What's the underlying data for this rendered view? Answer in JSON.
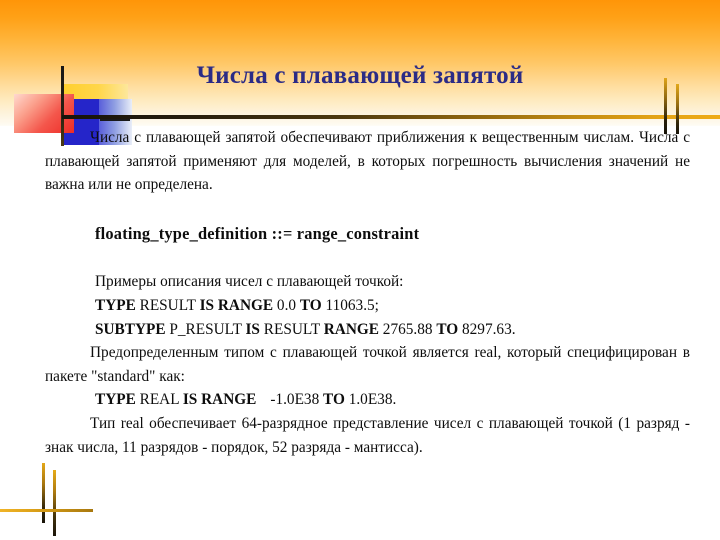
{
  "slide": {
    "title": "Числа с плавающей запятой",
    "title_color": "#2b2b86",
    "background_top_color": "#ff9508",
    "background_bottom_color": "#ffffff",
    "accent_gold": "#e0a419",
    "accent_dark": "#161208"
  },
  "body": {
    "paragraph1_line1": "Числа с плавающей запятой обеспечивают приближения к",
    "paragraph1_line2": "вещественным числам. Числа с плавающей запятой применяют для",
    "paragraph1_line3": "моделей, в которых погрешность вычисления значений не важна или не",
    "paragraph1_line4": "определена.",
    "paragraph1_full": "Числа с плавающей запятой обеспечивают приближения к вещественным числам. Числа с плавающей запятой применяют для моделей, в которых погрешность вычисления значений не важна или не определена.",
    "syntax_rule": "floating_type_definition ::=  range_constraint",
    "examples_lead": "Примеры описания чисел с плавающей точкой:",
    "example1": {
      "kw_type": "TYPE",
      "name": "RESULT",
      "kw_is_range": "IS RANGE",
      "low": "0.0",
      "kw_to": "TO",
      "high": "11063.5;"
    },
    "example2": {
      "kw_subtype": "SUBTYPE",
      "name": "P_RESULT",
      "kw_is": "IS",
      "base": "RESULT",
      "kw_range": "RANGE",
      "low": "2765.88",
      "kw_to": "TO",
      "high": "8297.63."
    },
    "paragraph2_line1": "Предопределенным типом с плавающей точкой является real,",
    "paragraph2_line2": "который специфицирован в пакете \"standard\" как:",
    "paragraph2_full": "Предопределенным типом с плавающей точкой является real, который специфицирован в пакете \"standard\" как:",
    "example3": {
      "kw_type": "TYPE",
      "name": "REAL",
      "kw_is_range": "IS RANGE",
      "low": "-1.0E38",
      "kw_to": "TO",
      "high": "1.0E38."
    },
    "paragraph3_line1": "Тип real обеспечивает 64-разрядное представление чисел с",
    "paragraph3_line2": "плавающей точкой (1 разряд - знак числа, 11 разрядов - порядок, 52",
    "paragraph3_line3": "разряда - мантисса).",
    "paragraph3_full": "Тип real обеспечивает 64-разрядное представление чисел с плавающей точкой (1 разряд - знак числа, 11 разрядов - порядок, 52 разряда - мантисса)."
  }
}
